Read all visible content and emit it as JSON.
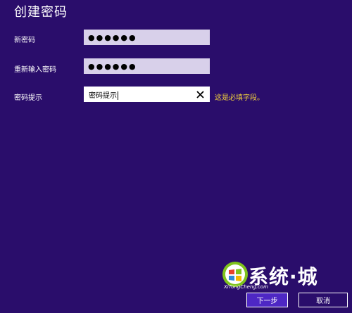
{
  "dialog": {
    "title": "创建密码"
  },
  "form": {
    "new_password": {
      "label": "新密码",
      "value": "●●●●●●"
    },
    "confirm_password": {
      "label": "重新输入密码",
      "value": "●●●●●●"
    },
    "password_hint": {
      "label": "密码提示",
      "value": "密码提示",
      "required_message": "这是必填字段。"
    }
  },
  "buttons": {
    "next_label": "下一步",
    "cancel_label": "取消"
  },
  "watermark": {
    "text": "系统·城",
    "sub": "XiTongCheng.com"
  },
  "colors": {
    "background": "#2a0d6b",
    "primary_button": "#4e27c4",
    "warning_text": "#f2d23c"
  }
}
